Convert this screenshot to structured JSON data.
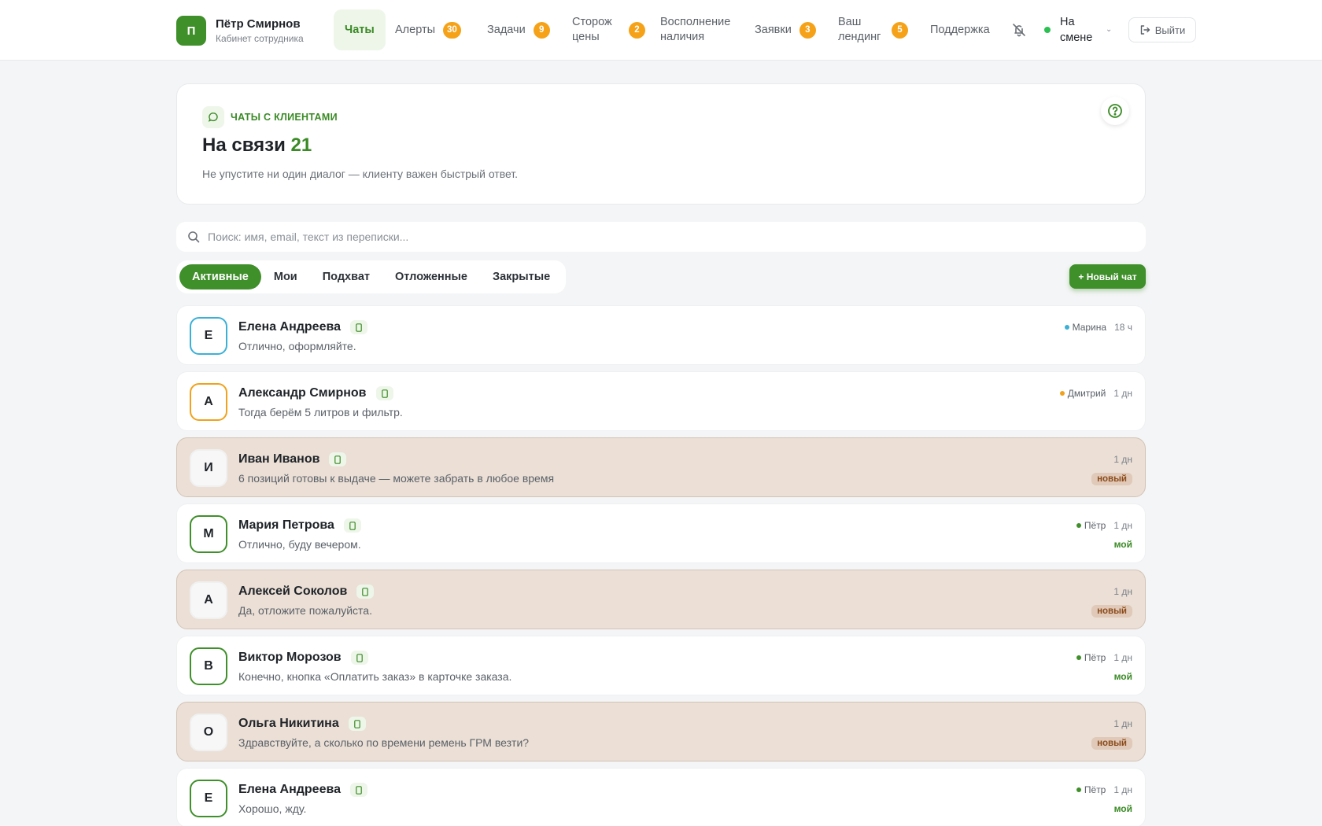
{
  "user": {
    "initial": "П",
    "name": "Пётр Смирнов",
    "role": "Кабинет сотрудника"
  },
  "nav": {
    "items": [
      {
        "label": "Чаты",
        "badge": null
      },
      {
        "label": "Алерты",
        "badge": "30"
      },
      {
        "label": "Задачи",
        "badge": "9"
      },
      {
        "label": "Сторож цены",
        "badge": "2"
      },
      {
        "label": "Восполнение наличия",
        "badge": null
      },
      {
        "label": "Заявки",
        "badge": "3"
      },
      {
        "label": "Ваш лендинг",
        "badge": "5"
      },
      {
        "label": "Поддержка",
        "badge": null
      }
    ],
    "shift_label": "На смене",
    "logout_label": "Выйти"
  },
  "hero": {
    "chip_label": "ЧАТЫ С КЛИЕНТАМИ",
    "title_prefix": "На связи",
    "count": "21",
    "subtitle": "Не упустите ни один диалог — клиенту важен быстрый ответ."
  },
  "search": {
    "placeholder": "Поиск: имя, email, текст из переписки..."
  },
  "tabs": [
    "Активные",
    "Мои",
    "Подхват",
    "Отложенные",
    "Закрытые"
  ],
  "new_chat_label": "+ Новый чат",
  "chats": [
    {
      "initial": "Е",
      "name": "Елена Андреева",
      "message": "Отлично, оформляйте.",
      "operator": "Марина",
      "operator_color": "#3bb0d6",
      "time": "18 ч",
      "flag": "",
      "unread": false,
      "avatar_color": "#3bb0d6"
    },
    {
      "initial": "А",
      "name": "Александр Смирнов",
      "message": "Тогда берём 5 литров и фильтр.",
      "operator": "Дмитрий",
      "operator_color": "#f0a21c",
      "time": "1 дн",
      "flag": "",
      "unread": false,
      "avatar_color": "#f0a21c"
    },
    {
      "initial": "И",
      "name": "Иван Иванов",
      "message": "6 позиций готовы к выдаче — можете забрать в любое время",
      "operator": "",
      "operator_color": "",
      "time": "1 дн",
      "flag": "новый",
      "unread": true,
      "avatar_color": "#f0f0f0"
    },
    {
      "initial": "М",
      "name": "Мария Петрова",
      "message": "Отлично, буду вечером.",
      "operator": "Пётр",
      "operator_color": "#3f8f2a",
      "time": "1 дн",
      "flag": "мой",
      "unread": false,
      "avatar_color": "#3f8f2a"
    },
    {
      "initial": "А",
      "name": "Алексей Соколов",
      "message": "Да, отложите пожалуйста.",
      "operator": "",
      "operator_color": "",
      "time": "1 дн",
      "flag": "новый",
      "unread": true,
      "avatar_color": "#f0f0f0"
    },
    {
      "initial": "В",
      "name": "Виктор Морозов",
      "message": "Конечно, кнопка «Оплатить заказ» в карточке заказа.",
      "operator": "Пётр",
      "operator_color": "#3f8f2a",
      "time": "1 дн",
      "flag": "мой",
      "unread": false,
      "avatar_color": "#3f8f2a"
    },
    {
      "initial": "О",
      "name": "Ольга Никитина",
      "message": "Здравствуйте, а сколько по времени ремень ГРМ везти?",
      "operator": "",
      "operator_color": "",
      "time": "1 дн",
      "flag": "новый",
      "unread": true,
      "avatar_color": "#f0f0f0"
    },
    {
      "initial": "Е",
      "name": "Елена Андреева",
      "message": "Хорошо, жду.",
      "operator": "Пётр",
      "operator_color": "#3f8f2a",
      "time": "1 дн",
      "flag": "мой",
      "unread": false,
      "avatar_color": "#3f8f2a"
    }
  ],
  "colors": {
    "accent": "#3f8f2a",
    "badge": "#f5a218",
    "unread_bg": "#ebdfd6"
  },
  "icons": {
    "hero_chip": "chat-bubble-icon",
    "help": "question-circle-icon",
    "search": "search-icon",
    "bell": "bell-off-icon",
    "logout": "logout-icon",
    "channel": "phone-icon"
  }
}
